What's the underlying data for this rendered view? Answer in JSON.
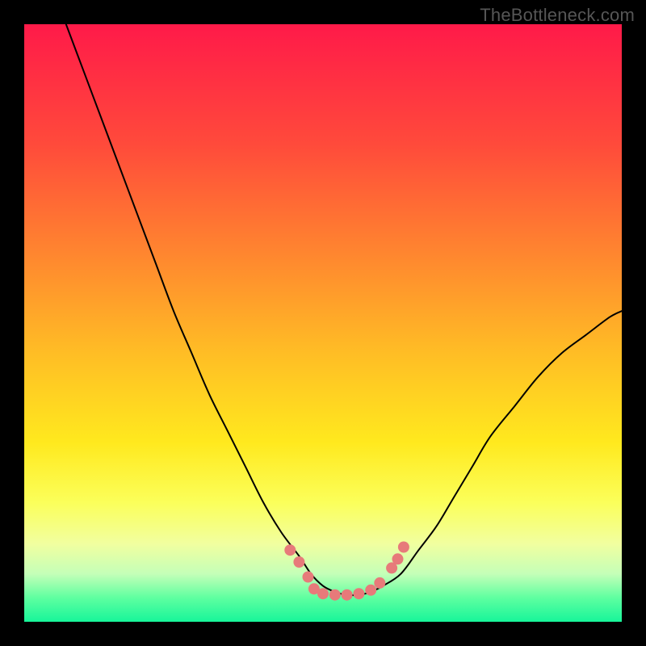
{
  "watermark": "TheBottleneck.com",
  "chart_data": {
    "type": "line",
    "title": "",
    "xlabel": "",
    "ylabel": "",
    "xlim": [
      0,
      100
    ],
    "ylim": [
      0,
      100
    ],
    "grid": false,
    "legend": false,
    "background": {
      "description": "vertical gradient red→orange→yellow→green",
      "stops": [
        {
          "pos": 0.0,
          "color": "#ff1a49"
        },
        {
          "pos": 0.2,
          "color": "#ff4a3b"
        },
        {
          "pos": 0.4,
          "color": "#ff8b2e"
        },
        {
          "pos": 0.55,
          "color": "#ffbd25"
        },
        {
          "pos": 0.7,
          "color": "#ffe91e"
        },
        {
          "pos": 0.8,
          "color": "#fbff5a"
        },
        {
          "pos": 0.87,
          "color": "#f1ffa0"
        },
        {
          "pos": 0.92,
          "color": "#c4ffb8"
        },
        {
          "pos": 0.96,
          "color": "#5effa0"
        },
        {
          "pos": 1.0,
          "color": "#17f59a"
        }
      ]
    },
    "series": [
      {
        "name": "bottleneck-curve",
        "color": "#000000",
        "stroke_width": 2,
        "x": [
          7,
          10,
          13,
          16,
          19,
          22,
          25,
          28,
          31,
          34,
          37,
          40,
          43,
          46,
          48,
          50,
          52,
          54,
          56,
          58,
          60,
          63,
          66,
          69,
          72,
          75,
          78,
          82,
          86,
          90,
          94,
          98,
          100
        ],
        "y": [
          100,
          92,
          84,
          76,
          68,
          60,
          52,
          45,
          38,
          32,
          26,
          20,
          15,
          11,
          8,
          6,
          5,
          4.5,
          4.5,
          5,
          6,
          8,
          12,
          16,
          21,
          26,
          31,
          36,
          41,
          45,
          48,
          51,
          52
        ]
      }
    ],
    "markers": {
      "name": "valley-dots",
      "color": "#e77a7a",
      "radius": 3.2,
      "points": [
        {
          "x": 44.5,
          "y": 12
        },
        {
          "x": 46.0,
          "y": 10
        },
        {
          "x": 47.5,
          "y": 7.5
        },
        {
          "x": 48.5,
          "y": 5.5
        },
        {
          "x": 50.0,
          "y": 4.7
        },
        {
          "x": 52.0,
          "y": 4.5
        },
        {
          "x": 54.0,
          "y": 4.5
        },
        {
          "x": 56.0,
          "y": 4.7
        },
        {
          "x": 58.0,
          "y": 5.3
        },
        {
          "x": 59.5,
          "y": 6.5
        },
        {
          "x": 61.5,
          "y": 9.0
        },
        {
          "x": 62.5,
          "y": 10.5
        },
        {
          "x": 63.5,
          "y": 12.5
        }
      ]
    }
  }
}
